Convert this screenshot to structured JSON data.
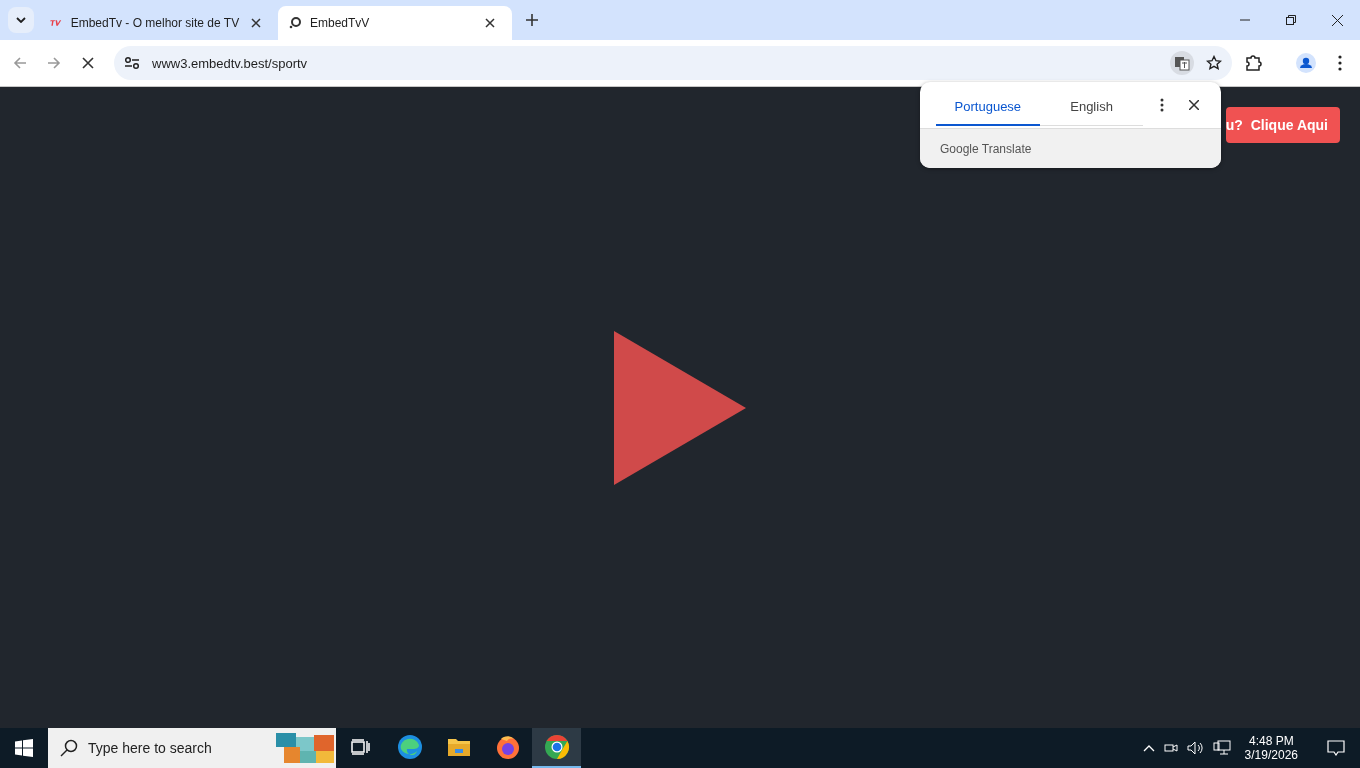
{
  "tabs": [
    {
      "title": "EmbedTv - O melhor site de TV",
      "selected": false,
      "kind": "tv"
    },
    {
      "title": "EmbedTvV",
      "selected": true,
      "kind": "loading"
    }
  ],
  "address_bar": {
    "url": "www3.embedtv.best/sportv"
  },
  "translate_popup": {
    "languages": [
      {
        "label": "Portuguese",
        "selected": true
      },
      {
        "label": "English",
        "selected": false
      }
    ],
    "footer": "Google Translate"
  },
  "page": {
    "promo_button": {
      "prefix": "u?",
      "label": "Clique Aqui"
    }
  },
  "taskbar": {
    "search_placeholder": "Type here to search",
    "apps": [
      {
        "kind": "taskview",
        "selected": false
      },
      {
        "kind": "edge",
        "selected": false
      },
      {
        "kind": "explorer",
        "selected": false
      },
      {
        "kind": "firefox",
        "selected": false
      },
      {
        "kind": "chrome",
        "selected": true
      }
    ],
    "time": "4:48 PM",
    "date": "3/19/2026"
  }
}
